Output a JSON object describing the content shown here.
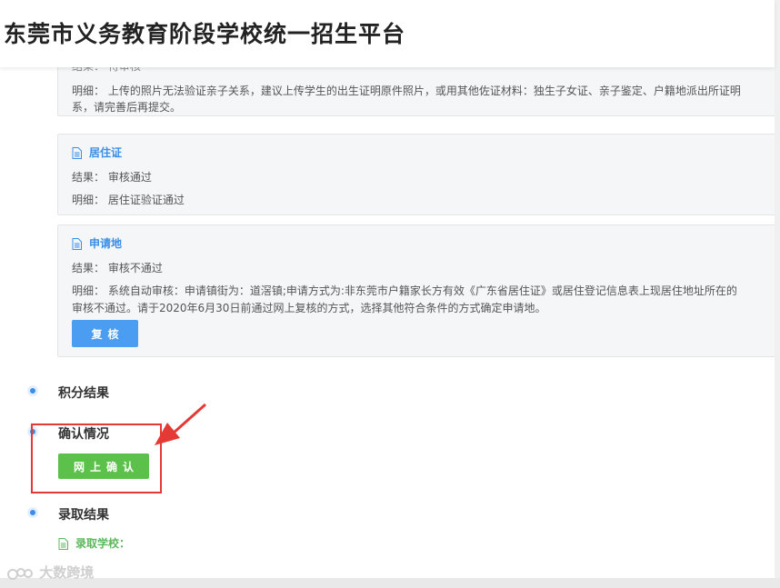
{
  "header": {
    "title": "东莞市义务教育阶段学校统一招生平台"
  },
  "cards": [
    {
      "result_text": "结果：  待审核",
      "detail_label": "明细：",
      "detail_text": "上传的照片无法验证亲子关系，建议上传学生的出生证明原件照片，或用其他佐证材料：独生子女证、亲子鉴定、户籍地派出所证明",
      "detail_cont": "系，请完善后再提交。"
    },
    {
      "title": "居住证",
      "result_label": "结果：",
      "result_value": "审核通过",
      "detail_label": "明细：",
      "detail_value": "居住证验证通过"
    },
    {
      "title": "申请地",
      "result_label": "结果：",
      "result_value": "审核不通过",
      "detail_line1": "明细：  系统自动审核：申请镇街为：道滘镇;申请方式为:非东莞市户籍家长方有效《广东省居住证》或居住登记信息表上现居住地址所在的",
      "detail_line2": "审核不通过。请于2020年6月30日前通过网上复核的方式，选择其他符合条件的方式确定申请地。",
      "button_label": "复核"
    }
  ],
  "sections": {
    "score": "积分结果",
    "confirm": "确认情况",
    "confirm_button": "网上确认",
    "admission": "录取结果",
    "admission_school": "录取学校："
  },
  "watermark": "大数跨境",
  "icons": {
    "doc": "document-icon",
    "timeline": "timeline-dot-icon",
    "arrow": "red-arrow-annotation"
  },
  "colors": {
    "accent_blue": "#3a8ee6",
    "button_blue": "#4a9df0",
    "button_green": "#5cc14a",
    "annotation_red": "#e53935"
  }
}
